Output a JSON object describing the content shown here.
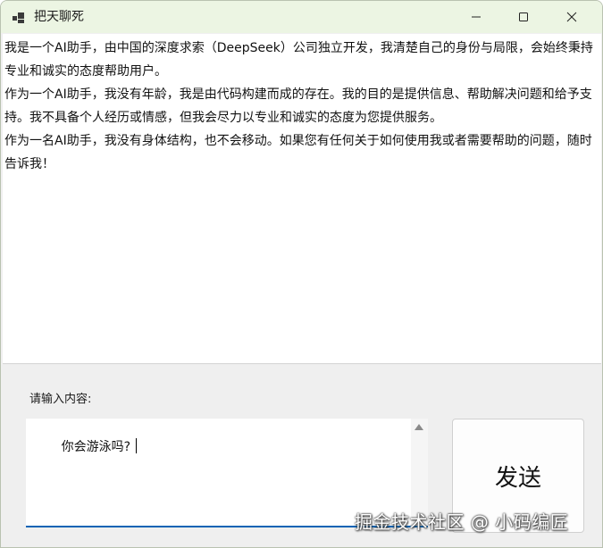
{
  "window": {
    "title": "把天聊死",
    "icons": {
      "app": "app-window-icon",
      "minimize": "minimize-icon",
      "maximize": "maximize-icon",
      "close": "close-icon"
    }
  },
  "chat": {
    "messages": [
      "我是一个AI助手，由中国的深度求索（DeepSeek）公司独立开发，我清楚自己的身份与局限，会始终秉持专业和诚实的态度帮助用户。",
      "作为一个AI助手，我没有年龄，我是由代码构建而成的存在。我的目的是提供信息、帮助解决问题和给予支持。我不具备个人经历或情感，但我会尽力以专业和诚实的态度为您提供服务。",
      "作为一名AI助手，我没有身体结构，也不会移动。如果您有任何关于如何使用我或者需要帮助的问题，随时告诉我！"
    ]
  },
  "input": {
    "label": "请输入内容:",
    "value": "你会游泳吗?"
  },
  "send_button": {
    "label": "发送"
  },
  "watermark": "掘金技术社区 @ 小码编匠",
  "colors": {
    "titlebar": "#ecf5e3",
    "focus_underline": "#0a63b4"
  }
}
